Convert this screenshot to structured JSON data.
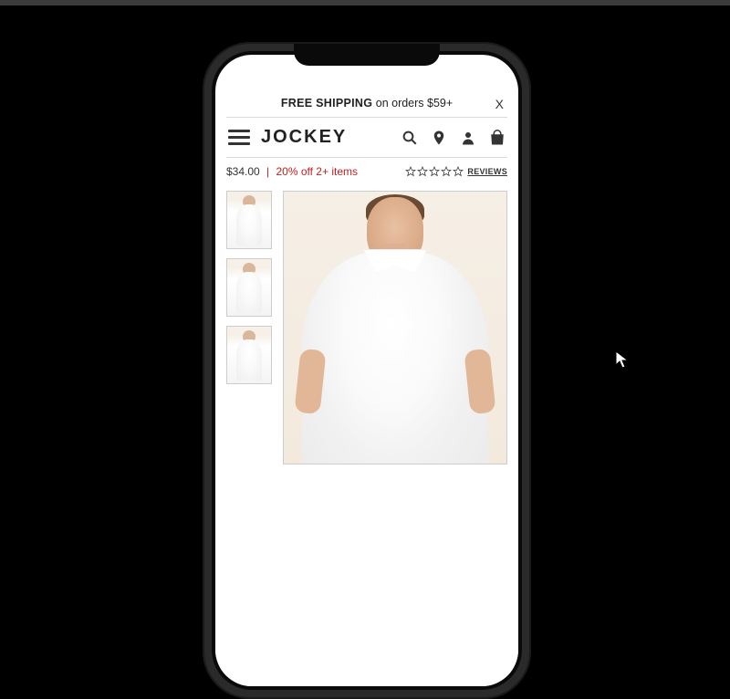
{
  "promo": {
    "strong": "FREE SHIPPING",
    "rest": " on orders $59+",
    "close": "X"
  },
  "brand": {
    "name": "JOCKEY"
  },
  "product": {
    "price": "$34.00",
    "promo_text": "20% off 2+ items",
    "reviews_label": "REVIEWS",
    "rating_stars": 0
  },
  "icons": {
    "menu": "menu-icon",
    "search": "search-icon",
    "location": "location-pin-icon",
    "account": "account-icon",
    "bag": "shopping-bag-icon"
  }
}
